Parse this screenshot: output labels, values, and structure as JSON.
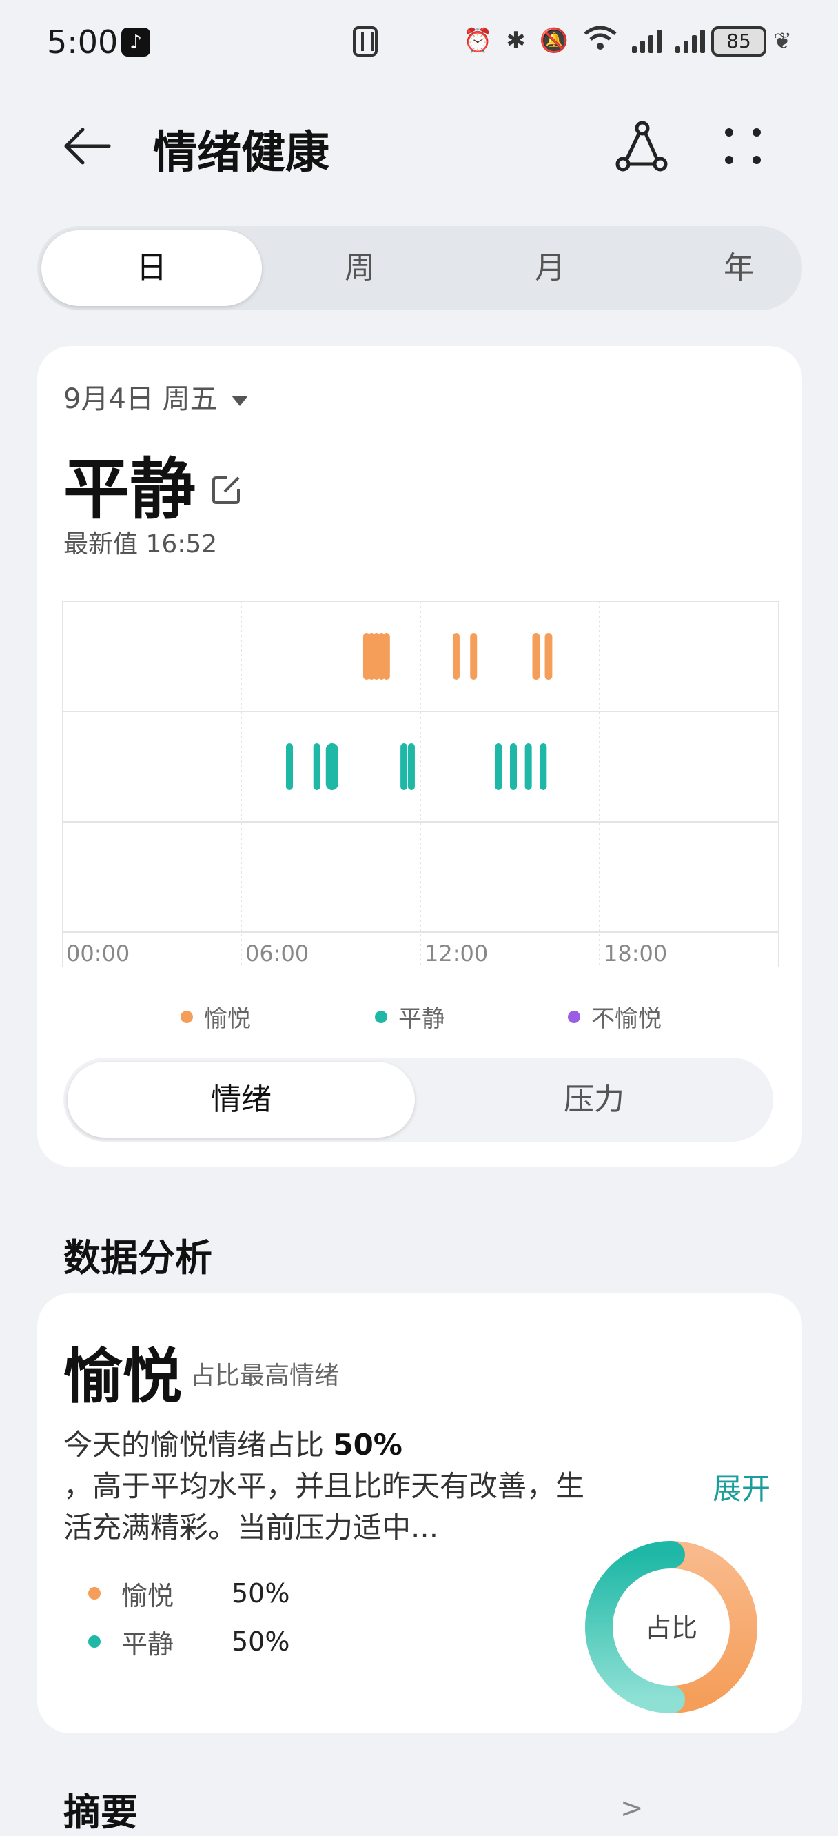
{
  "status_bar": {
    "time": "5:00",
    "battery": "85",
    "icons": [
      "tiktok-icon",
      "nfc-icon",
      "alarm-icon",
      "bluetooth-icon",
      "mute-icon",
      "wifi-icon",
      "signal-icon",
      "signal-icon",
      "battery-icon",
      "leaf-icon"
    ]
  },
  "header": {
    "title": "情绪健康"
  },
  "period_tabs": [
    "日",
    "周",
    "月",
    "年"
  ],
  "summary_card": {
    "date": "9月4日 周五",
    "mood": "平静",
    "latest": "最新值 16:52",
    "legend": [
      {
        "label": "愉悦",
        "color": "#f59e5a"
      },
      {
        "label": "平静",
        "color": "#1fb8a6"
      },
      {
        "label": "不愉悦",
        "color": "#9b5de5"
      }
    ],
    "toggle": [
      "情绪",
      "压力"
    ]
  },
  "chart_data": {
    "type": "scatter",
    "x_ticks": [
      "00:00",
      "06:00",
      "12:00",
      "18:00"
    ],
    "xlim": [
      "00:00",
      "24:00"
    ],
    "rows": [
      "愉悦",
      "平静",
      "不愉悦"
    ],
    "grid": true,
    "series": [
      {
        "name": "愉悦",
        "color": "#f59e5a",
        "marks": [
          {
            "start": "10:05",
            "end": "10:10"
          },
          {
            "start": "10:15",
            "end": "10:20"
          },
          {
            "start": "10:25",
            "end": "10:30"
          },
          {
            "start": "10:35",
            "end": "10:40"
          },
          {
            "start": "10:45",
            "end": "10:50"
          },
          {
            "start": "13:05",
            "end": "13:10"
          },
          {
            "start": "13:40",
            "end": "13:45"
          },
          {
            "start": "15:45",
            "end": "16:00"
          },
          {
            "start": "16:10",
            "end": "16:25"
          }
        ]
      },
      {
        "name": "平静",
        "color": "#1fb8a6",
        "marks": [
          {
            "start": "07:30",
            "end": "07:40"
          },
          {
            "start": "08:25",
            "end": "08:35"
          },
          {
            "start": "08:50",
            "end": "09:15"
          },
          {
            "start": "11:20",
            "end": "11:25"
          },
          {
            "start": "11:35",
            "end": "11:40"
          },
          {
            "start": "14:30",
            "end": "14:35"
          },
          {
            "start": "15:00",
            "end": "15:05"
          },
          {
            "start": "15:30",
            "end": "15:35"
          },
          {
            "start": "16:00",
            "end": "16:05"
          }
        ]
      },
      {
        "name": "不愉悦",
        "color": "#9b5de5",
        "marks": []
      }
    ]
  },
  "analysis": {
    "section_title": "数据分析",
    "top_emotion": "愉悦",
    "top_sub": "占比最高情绪",
    "text_pre": "今天的愉悦情绪占比 ",
    "text_bold": "50%",
    "text_post": "，高于平均水平，并且比昨天有改善，生活充满精彩。当前压力适中...",
    "expand": "展开",
    "ratios": [
      {
        "name": "愉悦",
        "pct": "50%",
        "value": 50,
        "color": "#f59e5a"
      },
      {
        "name": "平静",
        "pct": "50%",
        "value": 50,
        "color": "#1fb8a6"
      }
    ],
    "donut_label": "占比"
  },
  "footer": {
    "summary_title": "摘要",
    "more_label": ">"
  }
}
